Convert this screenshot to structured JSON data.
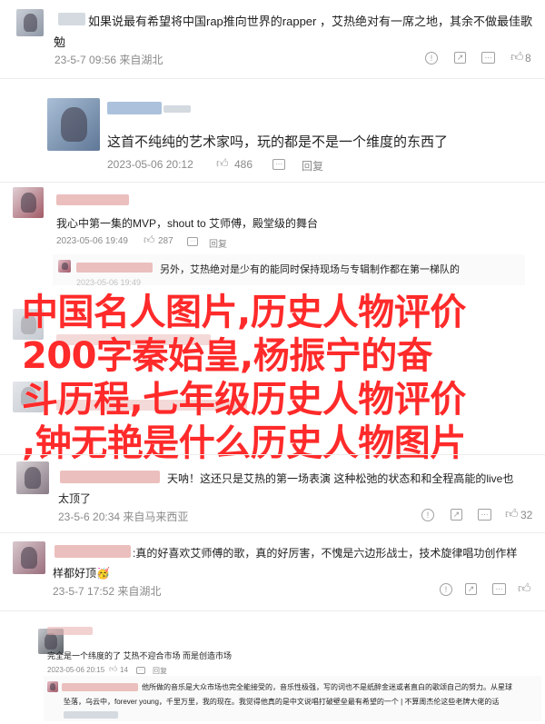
{
  "comments": [
    {
      "text": "如果说最有希望将中国rap推向世界的rapper ，艾热绝对有一席之地，其余不做最佳歌",
      "text2": "勉",
      "meta": "23-5-7 09:56 来自湖北",
      "like_count": "8"
    },
    {
      "text": "这首不纯纯的艺术家吗，玩的都是不是一个维度的东西了",
      "meta": "2023-05-06 20:12",
      "like_count": "486",
      "reply_label": "回复"
    },
    {
      "text": "我心中第一集的MVP，shout to 艾师傅，殿堂级的舞台",
      "meta": "2023-05-06 19:49",
      "like_count": "287",
      "reply_label": "回复"
    },
    {
      "reply_text": "另外，艾热绝对是少有的能同时保持现场与专辑制作都在第一梯队的",
      "meta": "2023-05-06 19:49"
    },
    {
      "text": "天呐！这还只是艾热的第一场表演 这种松弛的状态和和全程高能的live也",
      "text2": "太顶了",
      "meta": "23-5-6 20:34 来自马来西亚",
      "like_count": "32"
    },
    {
      "text": ":真的好喜欢艾师傅的歌，真的好厉害，不愧是六边形战士，技术旋律唱功创作样",
      "text2": "样都好顶🥳",
      "meta": "23-5-7 17:52 来自湖北"
    },
    {
      "text": "完全是一个纬度的了 艾热不迎合市场 而是创造市场",
      "meta": "2023-05-06 20:15",
      "like_count": "14",
      "reply_label": "回复",
      "reply_text": "他所做的音乐是大众市场也完全能接受的，音乐性极强，写的词也不是纸醉金迷或者直白的歌颂自己的努力。从星球",
      "reply_text2": "坠落，乌云中，forever young，千里万里，我的现在。我觉得他真的是中文说唱打破壁垒最有希望的一个 | 不算周杰伦这些老牌大佬的话"
    }
  ],
  "overlay": {
    "line1": "中国名人图片,历史人物评价",
    "line2": "200字秦始皇,杨振宁的奋",
    "line3": "斗历程,七年级历史人物评价",
    "line4": ",钟无艳是什么历史人物图片"
  },
  "colors": {
    "overlay": "#ff2a2a",
    "meta": "#8a8a8a"
  },
  "icons": [
    "report-icon",
    "share-icon",
    "comment-icon",
    "like-icon"
  ]
}
